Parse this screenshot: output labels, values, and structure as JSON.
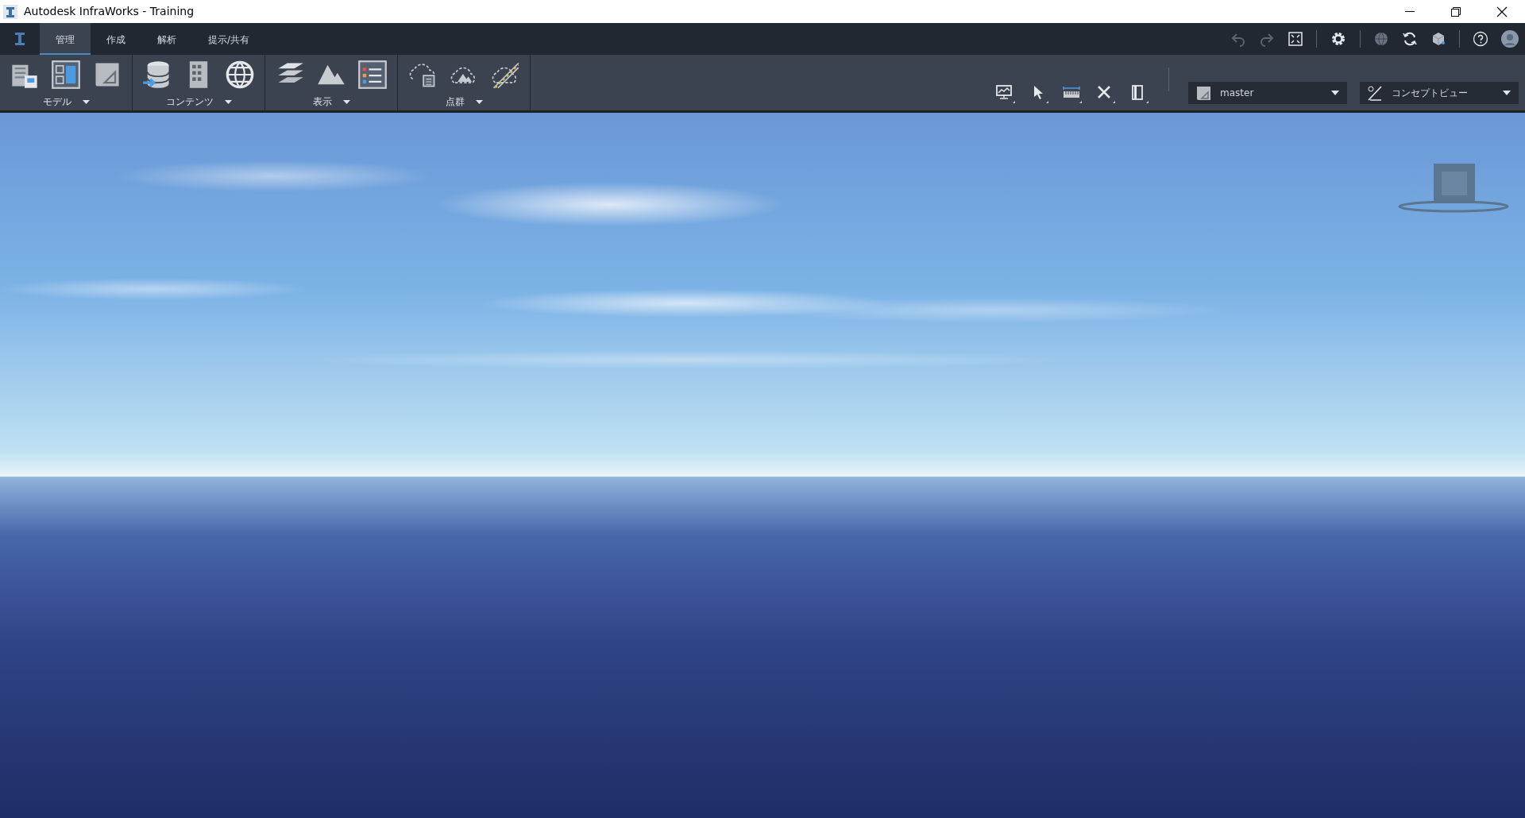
{
  "window": {
    "title": "Autodesk InfraWorks - Training"
  },
  "tabs": [
    {
      "label": "管理",
      "selected": true
    },
    {
      "label": "作成",
      "selected": false
    },
    {
      "label": "解析",
      "selected": false
    },
    {
      "label": "提示/共有",
      "selected": false
    }
  ],
  "ribbon_groups": [
    {
      "label": "モデル"
    },
    {
      "label": "コンテンツ"
    },
    {
      "label": "表示"
    },
    {
      "label": "点群"
    }
  ],
  "proposal_dropdown": {
    "value": "master"
  },
  "visual_style_dropdown": {
    "value": "コンセプトビュー"
  }
}
